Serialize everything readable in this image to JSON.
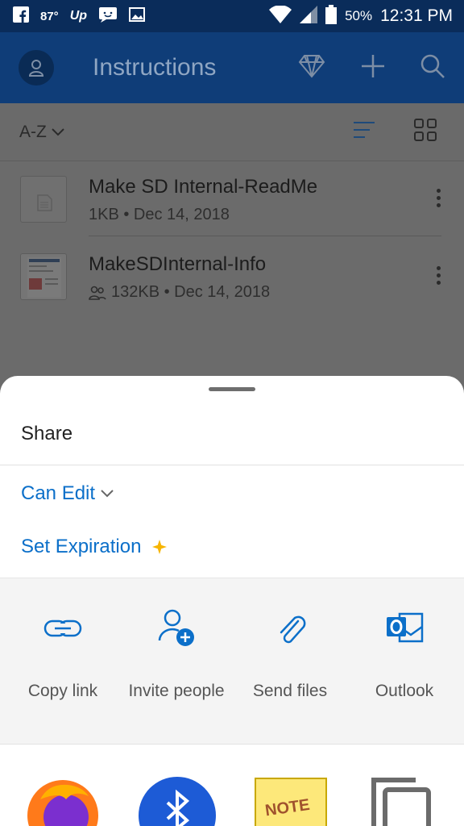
{
  "status_bar": {
    "temperature": "87°",
    "battery": "50%",
    "time": "12:31 PM"
  },
  "app_bar": {
    "title": "Instructions"
  },
  "toolbar": {
    "sort_label": "A-Z"
  },
  "files": [
    {
      "name": "Make SD Internal-ReadMe",
      "meta": "1KB • Dec 14, 2018",
      "shared": false
    },
    {
      "name": "MakeSDInternal-Info",
      "meta": "132KB • Dec 14, 2018",
      "shared": true
    }
  ],
  "share_sheet": {
    "title": "Share",
    "permission": "Can Edit",
    "set_expiration": "Set Expiration",
    "targets": [
      {
        "label": "Copy link",
        "icon": "link-icon"
      },
      {
        "label": "Invite people",
        "icon": "invite-person-icon"
      },
      {
        "label": "Send files",
        "icon": "paperclip-icon"
      },
      {
        "label": "Outlook",
        "icon": "outlook-icon"
      }
    ],
    "apps": [
      "firefox-icon",
      "bluetooth-icon",
      "note-icon",
      "copy-icon"
    ]
  },
  "colors": {
    "accent": "#0b6fc9",
    "header_bg": "#0f3d78",
    "status_bg": "#0a2c5a",
    "expiration_star": "#f7b500"
  }
}
